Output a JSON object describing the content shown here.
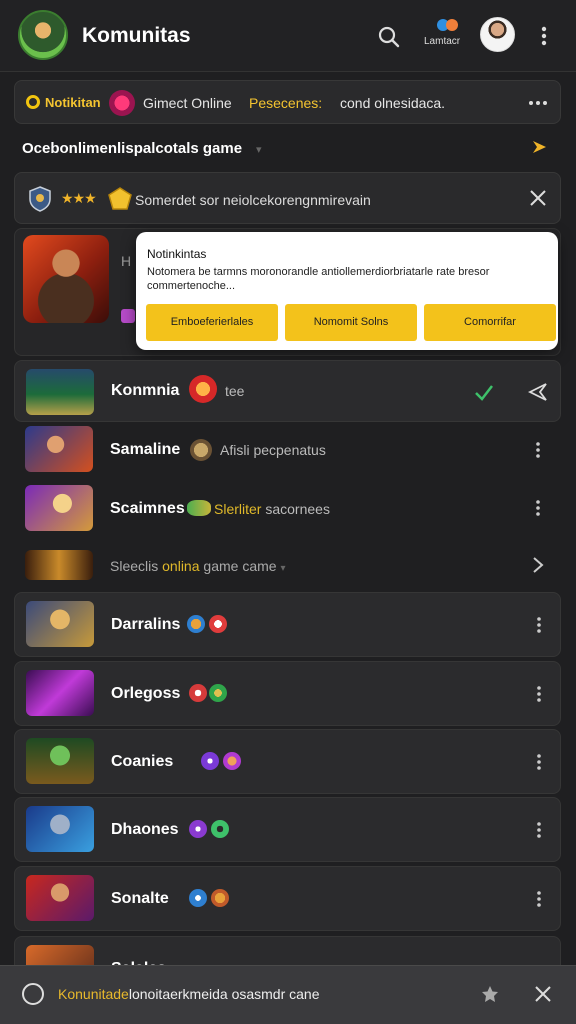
{
  "header": {
    "title": "Komunitas",
    "brand_text": "Lamtacr",
    "colors": {
      "accent": "#f3c21b",
      "background": "#1f1f21"
    }
  },
  "notification": {
    "label": "Notikitan",
    "status": "Gimect Online",
    "highlight": "Pesecenes:",
    "rest": "cond olnesidaca."
  },
  "section": {
    "title": "Ocebonlimenlispalcotals game"
  },
  "filter": {
    "text": "Somerdet sor neiolcekorengnmirevain"
  },
  "feature": {
    "hint": "H"
  },
  "popup": {
    "title": "Notinkintas",
    "body": "Notomera be tarmns moronorandle antiollemerdiorbriatarle rate bresor commertenoche...",
    "buttons": [
      "Emboeferierlales",
      "Nomomit Solns",
      "Comorrifar"
    ]
  },
  "rows": [
    {
      "name": "Konmnia",
      "desc": "tee",
      "icon": "check-icon"
    },
    {
      "name": "Samaline",
      "desc": "Afisli pecpenatus"
    },
    {
      "name": "Scaimnes",
      "desc": "Slerliter sacornees"
    },
    {
      "desc_full": "Sleeclis",
      "desc_hl": "onlina",
      "desc_rest": "game came"
    },
    {
      "name": "Darralins"
    },
    {
      "name": "Orlegoss"
    },
    {
      "name": "Coanies"
    },
    {
      "name": "Dhaones"
    },
    {
      "name": "Sonalte"
    },
    {
      "name": "Salales"
    }
  ],
  "bottom": {
    "highlight": "Konunitade",
    "text": "lonoitaerkmeida osasmdr cane"
  }
}
